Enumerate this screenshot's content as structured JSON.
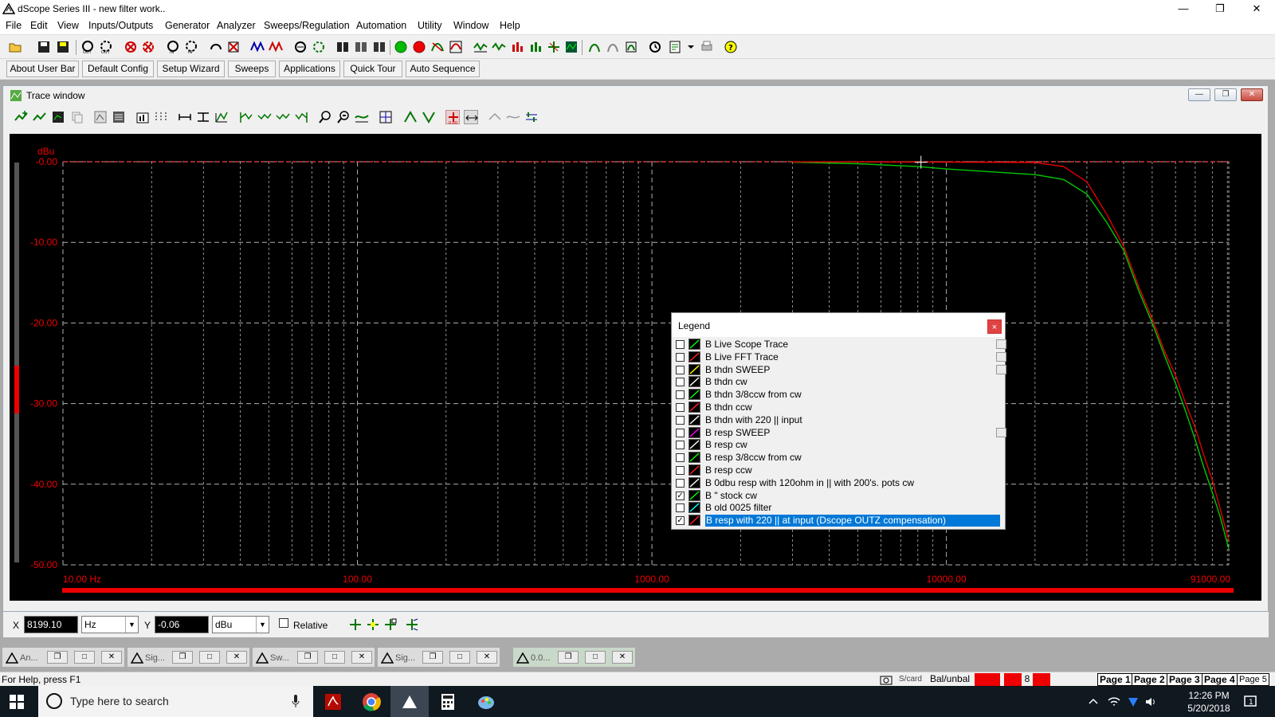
{
  "window": {
    "title": "dScope Series III - new filter work..",
    "controls": [
      "—",
      "❐",
      "✕"
    ]
  },
  "menu": [
    "File",
    "Edit",
    "View",
    "Inputs/Outputs",
    "Generator",
    "Analyzer",
    "Sweeps/Regulation",
    "Automation",
    "Utility",
    "Window",
    "Help"
  ],
  "userbar": [
    "About User Bar",
    "Default Config",
    "Setup Wizard",
    "Sweeps",
    "Applications",
    "Quick Tour",
    "Auto Sequence"
  ],
  "trace_window": {
    "title": "Trace window",
    "controls": [
      "—",
      "❐",
      "✕"
    ]
  },
  "chart_data": {
    "type": "line",
    "ylabel": "dBu",
    "xlabel_unit": "Hz",
    "xscale": "log",
    "xlim": [
      10,
      91000
    ],
    "ylim": [
      -50,
      0
    ],
    "grid": true,
    "y_ticks": [
      "-0.00",
      "-10.00",
      "-20.00",
      "-30.00",
      "-40.00",
      "-50.00"
    ],
    "x_tick_labels": [
      {
        "value": 10,
        "label": "10.00 Hz"
      },
      {
        "value": 100,
        "label": "100.00"
      },
      {
        "value": 1000,
        "label": "1000.00"
      },
      {
        "value": 10000,
        "label": "10000.00"
      },
      {
        "value": 91000,
        "label": "91000.00"
      }
    ],
    "reference_line_db": 0,
    "cursor": {
      "x": 8199.1,
      "y": -0.06
    },
    "series": [
      {
        "name": "B \" stock cw",
        "color": "#00c800",
        "x": [
          3000,
          5000,
          8000,
          10000,
          15000,
          20000,
          25000,
          30000,
          35000,
          40000,
          45000,
          50000,
          55000,
          60000,
          65000,
          70000,
          75000,
          80000,
          85000,
          91000
        ],
        "y": [
          -0.05,
          -0.25,
          -0.6,
          -0.9,
          -1.3,
          -1.6,
          -2.2,
          -4.0,
          -7.5,
          -11.0,
          -16.0,
          -20.0,
          -24.0,
          -27.5,
          -31.0,
          -34.5,
          -38.0,
          -41.0,
          -44.0,
          -48.0
        ]
      },
      {
        "name": "B resp with 220 || at input (Dscope OUTZ compensation)",
        "color": "#e00000",
        "x": [
          3000,
          8000,
          15000,
          20000,
          25000,
          30000,
          35000,
          40000,
          45000,
          50000,
          55000,
          60000,
          65000,
          70000,
          75000,
          80000,
          85000,
          91000
        ],
        "y": [
          -0.02,
          -0.04,
          -0.08,
          -0.1,
          -0.6,
          -2.5,
          -6.5,
          -10.5,
          -15.5,
          -19.5,
          -23.5,
          -26.5,
          -30.0,
          -33.0,
          -36.5,
          -39.5,
          -43.0,
          -47.0
        ]
      }
    ]
  },
  "legend": {
    "title": "Legend",
    "close": "×",
    "items": [
      {
        "label": "B  Live Scope Trace",
        "checked": false,
        "color": "#00ff00",
        "copy": true
      },
      {
        "label": "B  Live FFT Trace",
        "checked": false,
        "color": "#ff2020",
        "copy": true
      },
      {
        "label": "B  thdn SWEEP",
        "checked": false,
        "color": "#ffff00",
        "copy": true
      },
      {
        "label": "B  thdn cw",
        "checked": false,
        "color": "#ffffff",
        "copy": false
      },
      {
        "label": "B  thdn 3/8ccw from cw",
        "checked": false,
        "color": "#00ff00",
        "copy": false
      },
      {
        "label": "B  thdn ccw",
        "checked": false,
        "color": "#ff2020",
        "copy": false
      },
      {
        "label": "B  thdn with 220 || input",
        "checked": false,
        "color": "#ffffff",
        "copy": false
      },
      {
        "label": "B  resp SWEEP",
        "checked": false,
        "color": "#ff00ff",
        "copy": true
      },
      {
        "label": "B  resp cw",
        "checked": false,
        "color": "#ffffff",
        "copy": false
      },
      {
        "label": "B  resp 3/8ccw from cw",
        "checked": false,
        "color": "#00ff00",
        "copy": false
      },
      {
        "label": "B  resp ccw",
        "checked": false,
        "color": "#ff2020",
        "copy": false
      },
      {
        "label": "B  0dbu resp with 120ohm in || with 200's. pots cw",
        "checked": false,
        "color": "#ffffff",
        "copy": false
      },
      {
        "label": "B  \" stock cw",
        "checked": true,
        "color": "#00ff00",
        "copy": false
      },
      {
        "label": "B  old 0025 filter",
        "checked": false,
        "color": "#00ffff",
        "copy": false
      },
      {
        "label": "B  resp with 220 || at input (Dscope OUTZ compensation)",
        "checked": true,
        "color": "#ff2020",
        "copy": false,
        "selected": true
      }
    ]
  },
  "cursorbar": {
    "x_label": "X",
    "x_value": "8199.10",
    "x_unit": "Hz",
    "y_label": "Y",
    "y_value": "-0.06",
    "y_unit": "dBu",
    "relative_label": "Relative"
  },
  "mdi_tabs": [
    {
      "label": "An..."
    },
    {
      "label": "Sig..."
    },
    {
      "label": "Sw..."
    },
    {
      "label": "Sig..."
    },
    {
      "label": "0.0..."
    }
  ],
  "statusbar": {
    "help": "For Help, press F1",
    "card": "S/card",
    "balun": "Bal/unbal",
    "count": "8",
    "pages": [
      "Page 1",
      "Page 2",
      "Page 3",
      "Page 4",
      "Page 5"
    ]
  },
  "taskbar": {
    "search_placeholder": "Type here to search",
    "time": "12:26 PM",
    "date": "5/20/2018",
    "notifications": "1"
  }
}
